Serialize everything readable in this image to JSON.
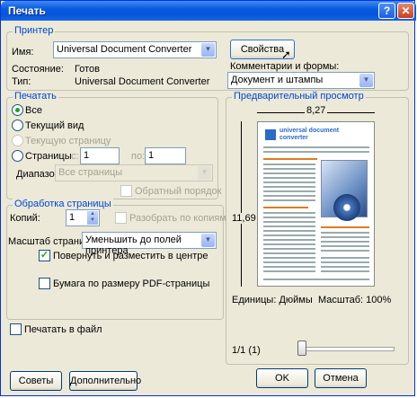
{
  "window": {
    "title": "Печать"
  },
  "printer": {
    "legend": "Принтер",
    "name_label": "Имя:",
    "name_value": "Universal Document Converter",
    "properties_button": "Свойства",
    "status_label": "Состояние:",
    "status_value": "Готов",
    "type_label": "Тип:",
    "type_value": "Universal Document Converter",
    "comments_label": "Комментарии и формы:",
    "comments_value": "Документ и штампы"
  },
  "print_range": {
    "legend": "Печатать",
    "all": "Все",
    "current_view": "Текущий вид",
    "current_page": "Текущую страницу",
    "pages": "Страницы",
    "from_label": "с:",
    "from_value": "1",
    "to_label": "по:",
    "to_value": "1",
    "subset_label": "Диапазон:",
    "subset_value": "Все страницы",
    "reverse_label": "Обратный порядок"
  },
  "handling": {
    "legend": "Обработка страницы",
    "copies_label": "Копий:",
    "copies_value": "1",
    "collate_label": "Разобрать по копиям",
    "scaling_label": "Масштаб страницы:",
    "scaling_value": "Уменьшить до полей принтера",
    "autorotate_label": "Повернуть и разместить в центре",
    "pdf_size_label": "Бумага по размеру PDF-страницы"
  },
  "print_to_file": "Печатать в файл",
  "preview": {
    "legend": "Предварительный просмотр",
    "width": "8,27",
    "height": "11,69",
    "units": "Единицы: Дюймы",
    "zoom": "Масштаб: 100%",
    "page": "1/1 (1)",
    "doc_title_1": "universal document",
    "doc_title_2": "converter"
  },
  "buttons": {
    "tips": "Советы",
    "advanced": "Дополнительно",
    "ok": "OK",
    "cancel": "Отмена"
  }
}
